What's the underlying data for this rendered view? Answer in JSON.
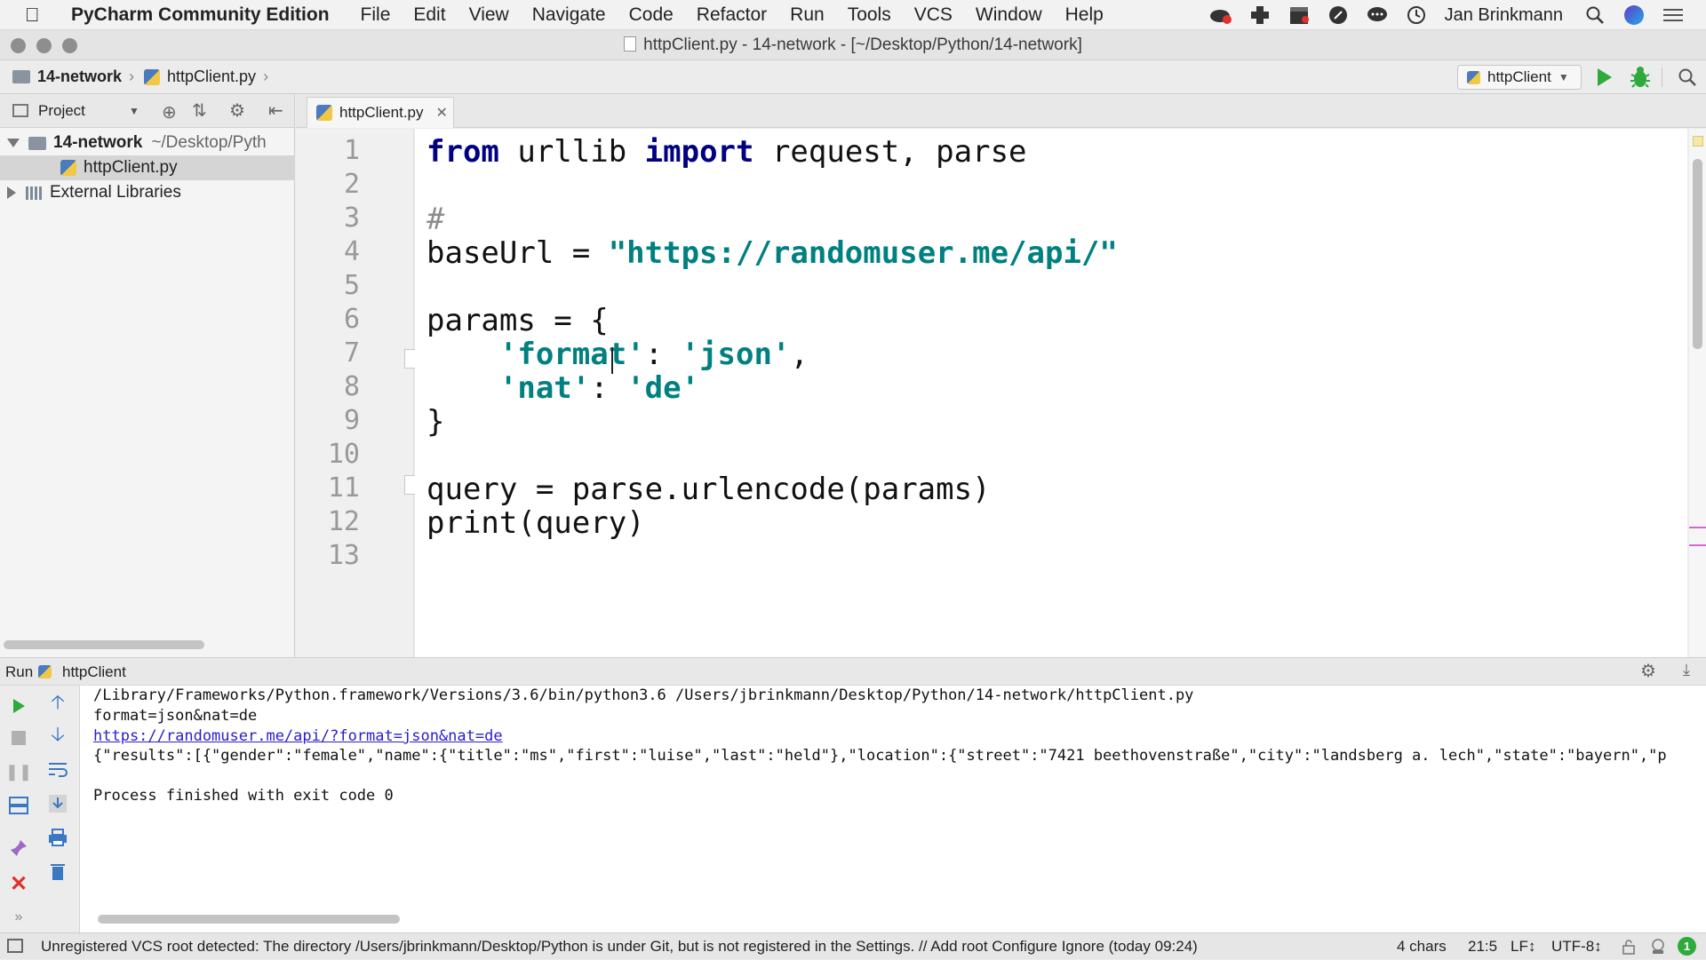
{
  "menubar": {
    "app_name": "PyCharm Community Edition",
    "items": [
      "File",
      "Edit",
      "View",
      "Navigate",
      "Code",
      "Refactor",
      "Run",
      "Tools",
      "VCS",
      "Window",
      "Help"
    ],
    "user": "Jan Brinkmann"
  },
  "window": {
    "title": "httpClient.py - 14-network - [~/Desktop/Python/14-network]"
  },
  "navbar": {
    "crumb_project": "14-network",
    "crumb_file": "httpClient.py",
    "run_config": "httpClient"
  },
  "project_panel": {
    "header": "Project",
    "root_name": "14-network",
    "root_path": "~/Desktop/Pyth",
    "file": "httpClient.py",
    "external": "External Libraries"
  },
  "editor": {
    "tab_label": "httpClient.py",
    "line_numbers": [
      "1",
      "2",
      "3",
      "4",
      "5",
      "6",
      "7",
      "8",
      "9",
      "10",
      "11",
      "12",
      "13"
    ],
    "code": {
      "l1_from": "from",
      "l1_mod": " urllib ",
      "l1_import": "import",
      "l1_rest": " request, parse",
      "l3": "#",
      "l4_a": "baseUrl = ",
      "l4_str": "\"https://randomuser.me/api/\"",
      "l6": "params = {",
      "l7_indent": "    ",
      "l7_k": "'format'",
      "l7_colon": ": ",
      "l7_v": "'json'",
      "l7_end": ",",
      "l8_indent": "    ",
      "l8_k": "'nat'",
      "l8_colon": ": ",
      "l8_v": "'de'",
      "l9": "}",
      "l11": "query = parse.urlencode(params)",
      "l12": "print(query)"
    }
  },
  "run_panel": {
    "label": "Run",
    "config": "httpClient",
    "output": [
      "/Library/Frameworks/Python.framework/Versions/3.6/bin/python3.6 /Users/jbrinkmann/Desktop/Python/14-network/httpClient.py",
      "format=json&nat=de",
      "https://randomuser.me/api/?format=json&nat=de",
      "{\"results\":[{\"gender\":\"female\",\"name\":{\"title\":\"ms\",\"first\":\"luise\",\"last\":\"held\"},\"location\":{\"street\":\"7421 beethovenstraße\",\"city\":\"landsberg a. lech\",\"state\":\"bayern\",\"p",
      "",
      "Process finished with exit code 0"
    ]
  },
  "statusbar": {
    "message": "Unregistered VCS root detected: The directory /Users/jbrinkmann/Desktop/Python is under Git, but is not registered in the Settings. // Add root  Configure  Ignore (today 09:24)",
    "chars": "4 chars",
    "position": "21:5",
    "line_sep": "LF↕",
    "encoding": "UTF-8↕",
    "event_count": "1"
  }
}
